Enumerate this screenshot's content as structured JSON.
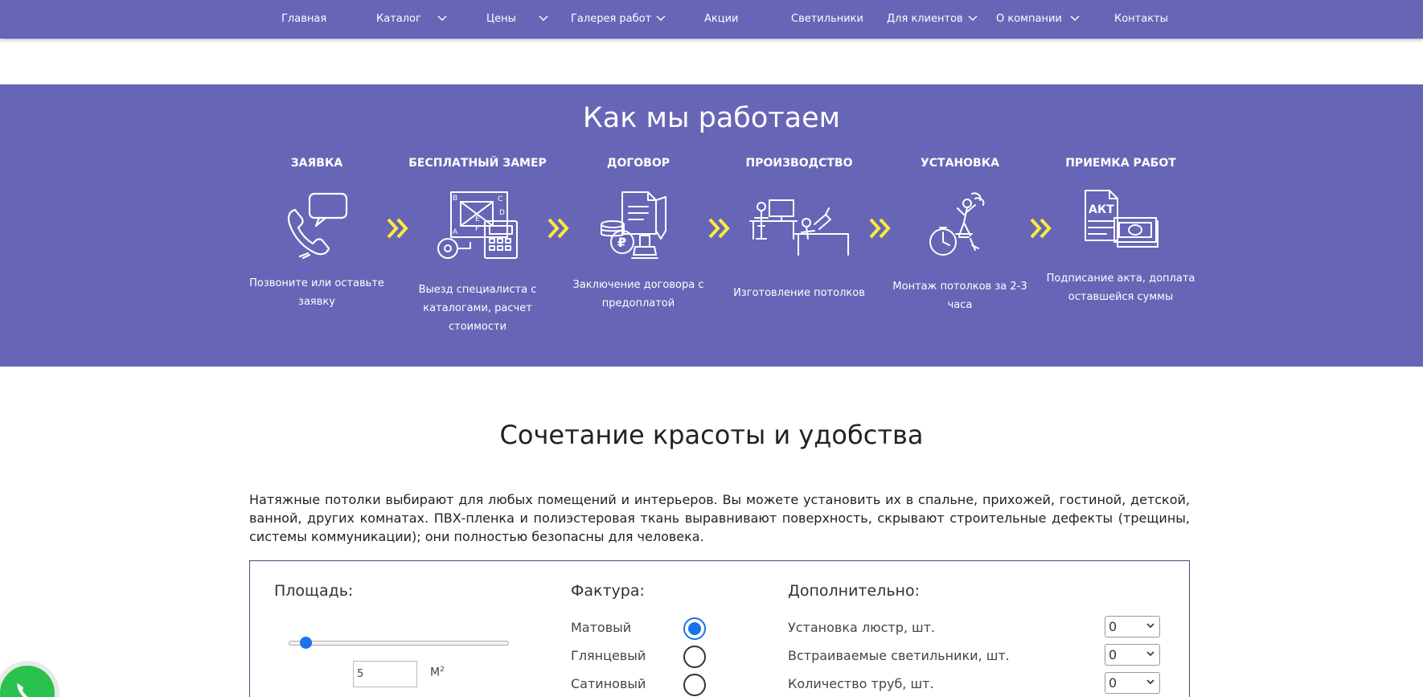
{
  "nav": {
    "items": [
      {
        "label": "Главная",
        "has_dropdown": false
      },
      {
        "label": "Каталог",
        "has_dropdown": true
      },
      {
        "label": "Цены",
        "has_dropdown": true
      },
      {
        "label": "Галерея работ",
        "has_dropdown": true
      },
      {
        "label": "Акции",
        "has_dropdown": false
      },
      {
        "label": "Светильники",
        "has_dropdown": false
      },
      {
        "label": "Для клиентов",
        "has_dropdown": true
      },
      {
        "label": "О компании",
        "has_dropdown": true
      },
      {
        "label": "Контакты",
        "has_dropdown": false
      }
    ]
  },
  "how": {
    "title": "Как мы работаем",
    "steps": [
      {
        "title": "ЗАЯВКА",
        "desc": "Позвоните или оставьте заявку",
        "icon": "phone-chat-icon"
      },
      {
        "title": "БЕСПЛАТНЫЙ ЗАМЕР",
        "desc": "Выезд специалиста с каталогами, расчет стоимости",
        "icon": "blueprint-calculator-icon"
      },
      {
        "title": "ДОГОВОР",
        "desc": "Заключение договора с предоплатой",
        "icon": "contract-stamp-icon"
      },
      {
        "title": "ПРОИЗВОДСТВО",
        "desc": "Изготовление потолков",
        "icon": "workshop-icon"
      },
      {
        "title": "УСТАНОВКА",
        "desc": "Монтаж потолков за 2-3 часа",
        "icon": "installer-clock-icon"
      },
      {
        "title": "ПРИЕМКА РАБОТ",
        "desc": "Подписание акта, доплата оставшейся суммы",
        "icon": "act-money-icon"
      }
    ],
    "act_text": "АКТ",
    "blueprint_letters": [
      "B",
      "C",
      "D",
      "A",
      "E",
      "F"
    ]
  },
  "section": {
    "title": "Сочетание красоты и удобства",
    "intro": "Натяжные потолки выбирают для любых помещений и интерьеров. Вы можете установить их в спальне, прихожей, гостиной, детской, ванной, других комнатах. ПВХ-пленка и полиэстеровая ткань выравнивают поверхность, скрывают строительные дефекты (трещины, системы коммуникации); они полностью безопасны для человека."
  },
  "calc": {
    "area_label": "Площадь:",
    "area_value": "5",
    "area_unit": "М",
    "area_unit_sup": "2",
    "slider_fraction": 0.04,
    "texture_label": "Фактура:",
    "textures": [
      {
        "label": "Матовый",
        "checked": true
      },
      {
        "label": "Глянцевый",
        "checked": false
      },
      {
        "label": "Сатиновый",
        "checked": false
      }
    ],
    "extra_label": "Дополнительно:",
    "extras": [
      {
        "label": "Установка люстр, шт.",
        "value": "0"
      },
      {
        "label": "Встраиваемые светильники, шт.",
        "value": "0"
      },
      {
        "label": "Количество труб, шт.",
        "value": "0"
      }
    ]
  },
  "colors": {
    "brand": "#6765b6",
    "arrow": "#ffeb3b",
    "radio": "#1a73e8",
    "whatsapp": "#29c24d"
  }
}
